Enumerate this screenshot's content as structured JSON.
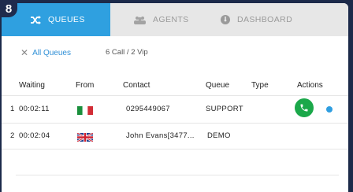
{
  "badge": "8",
  "tabs": [
    {
      "label": "QUEUES",
      "icon": "shuffle-icon",
      "active": true
    },
    {
      "label": "AGENTS",
      "icon": "users-icon",
      "active": false
    },
    {
      "label": "DASHBOARD",
      "icon": "speedometer-icon",
      "active": false
    }
  ],
  "filter": {
    "clear_icon": "close-icon",
    "label": "All Queues"
  },
  "summary": "6 Call / 2 Vip",
  "columns": [
    "Waiting",
    "From",
    "Contact",
    "Queue",
    "Type",
    "Actions"
  ],
  "rows": [
    {
      "index": "1",
      "waiting": "00:02:11",
      "from": "italy-flag-icon",
      "contact": "0295449067",
      "queue": "SUPPORT",
      "type": "",
      "action_icon": "phone-icon",
      "status_color": "#2f9ee0"
    },
    {
      "index": "2",
      "waiting": "00:02:04",
      "from": "uk-flag-icon",
      "contact": "John Evans[3477...",
      "queue": "DEMO",
      "type": ""
    }
  ],
  "colors": {
    "accent": "#2fa0e0",
    "call_green": "#1ba84a"
  }
}
